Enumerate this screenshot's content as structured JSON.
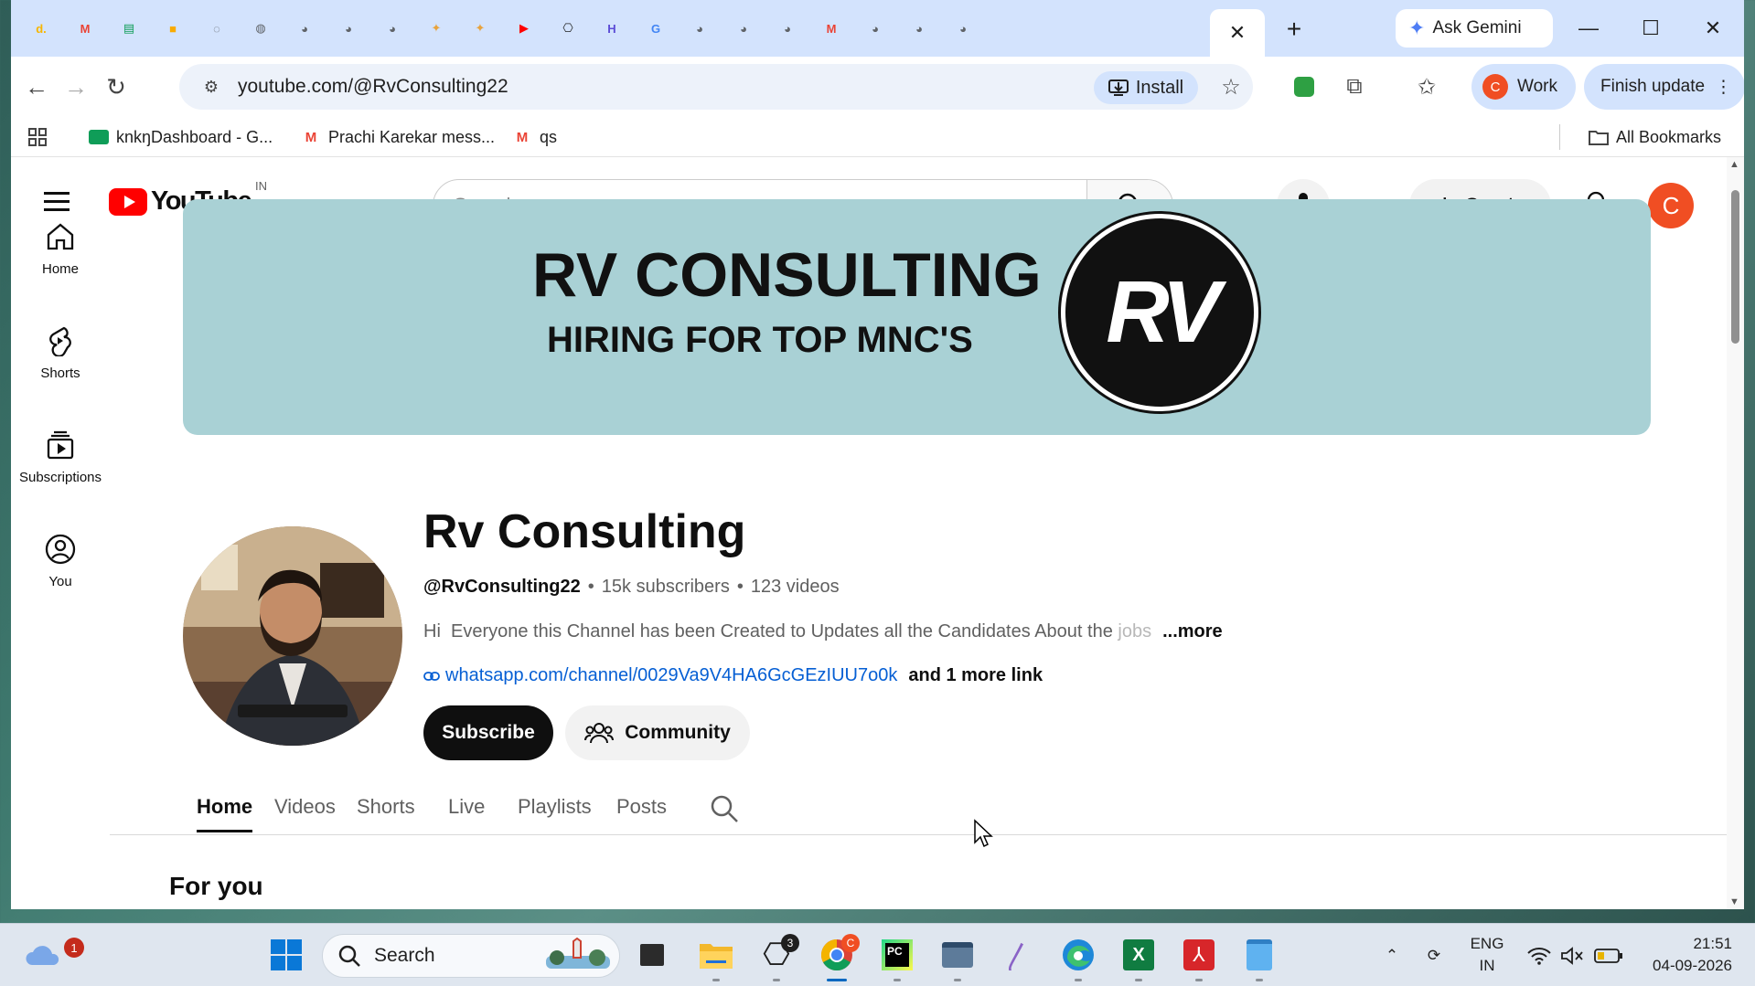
{
  "browser": {
    "tabs": [
      {
        "icon": "d-icon",
        "glyph": "d.",
        "color": "#f7b500"
      },
      {
        "icon": "gmail-icon",
        "glyph": "M",
        "color": "#ea4335"
      },
      {
        "icon": "sheets-icon",
        "glyph": "▤",
        "color": "#0f9d58"
      },
      {
        "icon": "meet-icon",
        "glyph": "■",
        "color": "#f9ab00"
      },
      {
        "icon": "loading-icon",
        "glyph": "◌",
        "color": "#5f6368"
      },
      {
        "icon": "loading-icon",
        "glyph": "◍",
        "color": "#5f6368"
      },
      {
        "icon": "globe-icon",
        "glyph": "◕",
        "color": "#5f6368"
      },
      {
        "icon": "globe-icon",
        "glyph": "◕",
        "color": "#5f6368"
      },
      {
        "icon": "globe-icon",
        "glyph": "◕",
        "color": "#5f6368"
      },
      {
        "icon": "puzzle-icon",
        "glyph": "✦",
        "color": "#e8a33d"
      },
      {
        "icon": "puzzle-icon",
        "glyph": "✦",
        "color": "#e8a33d"
      },
      {
        "icon": "youtube-icon",
        "glyph": "▶",
        "color": "#ff0000"
      },
      {
        "icon": "chatgpt-icon",
        "glyph": "⎔",
        "color": "#1f1f1f"
      },
      {
        "icon": "linear-icon",
        "glyph": "H",
        "color": "#5b4bd6"
      },
      {
        "icon": "google-icon",
        "glyph": "G",
        "color": "#4285f4"
      },
      {
        "icon": "globe-icon",
        "glyph": "◕",
        "color": "#5f6368"
      },
      {
        "icon": "globe-icon",
        "glyph": "◕",
        "color": "#5f6368"
      },
      {
        "icon": "globe-icon",
        "glyph": "◕",
        "color": "#5f6368"
      },
      {
        "icon": "gmail-icon",
        "glyph": "M",
        "color": "#ea4335"
      },
      {
        "icon": "globe-icon",
        "glyph": "◕",
        "color": "#5f6368"
      },
      {
        "icon": "globe-icon",
        "glyph": "◕",
        "color": "#5f6368"
      },
      {
        "icon": "globe-icon",
        "glyph": "◕",
        "color": "#5f6368"
      }
    ],
    "active_tab_close": "✕",
    "new_tab": "+",
    "gemini_label": "Ask Gemini",
    "url": "youtube.com/@RvConsulting22",
    "install_label": "Install",
    "profile_initial": "C",
    "profile_label": "Work",
    "finish_update_label": "Finish update",
    "bookmarks": [
      {
        "label": "knkŋDashboard - G...",
        "icon": "dashboard-icon"
      },
      {
        "label": "Prachi Karekar mess...",
        "icon": "gmail-icon"
      },
      {
        "label": "qs",
        "icon": "gmail-icon"
      }
    ],
    "all_bookmarks_label": "All Bookmarks"
  },
  "youtube": {
    "logo_text": "YouTube",
    "country_code": "IN",
    "search_placeholder": "Search",
    "create_label": "Create",
    "avatar_initial": "C",
    "sidebar": [
      {
        "label": "Home",
        "icon": "home-icon"
      },
      {
        "label": "Shorts",
        "icon": "shorts-icon"
      },
      {
        "label": "Subscriptions",
        "icon": "subscriptions-icon"
      },
      {
        "label": "You",
        "icon": "you-icon"
      }
    ],
    "banner": {
      "title": "RV CONSULTING",
      "subtitle": "HIRING FOR TOP MNC'S",
      "logo_text": "RV"
    },
    "channel": {
      "name": "Rv Consulting",
      "handle": "@RvConsulting22",
      "subscribers": "15k subscribers",
      "videos": "123 videos",
      "separator": "•",
      "description": "Hi  Everyone this Channel has been Created to Updates all the Candidates About the ",
      "description_fade": "jobs",
      "more_label": "...more",
      "link_url": "whatsapp.com/channel/0029Va9V4HA6GcGEzIUU7o0k",
      "link_more": "and 1 more link",
      "subscribe_label": "Subscribe",
      "community_label": "Community"
    },
    "tabs": [
      {
        "label": "Home",
        "active": true
      },
      {
        "label": "Videos",
        "active": false
      },
      {
        "label": "Shorts",
        "active": false
      },
      {
        "label": "Live",
        "active": false
      },
      {
        "label": "Playlists",
        "active": false
      },
      {
        "label": "Posts",
        "active": false
      }
    ],
    "section_title": "For you"
  },
  "taskbar": {
    "weather_badge": "1",
    "search_label": "Search",
    "chatgpt_badge": "3",
    "chrome_badge": "C",
    "lang_line1": "ENG",
    "lang_line2": "IN",
    "time": "21:51",
    "date": "04-09-2026"
  }
}
